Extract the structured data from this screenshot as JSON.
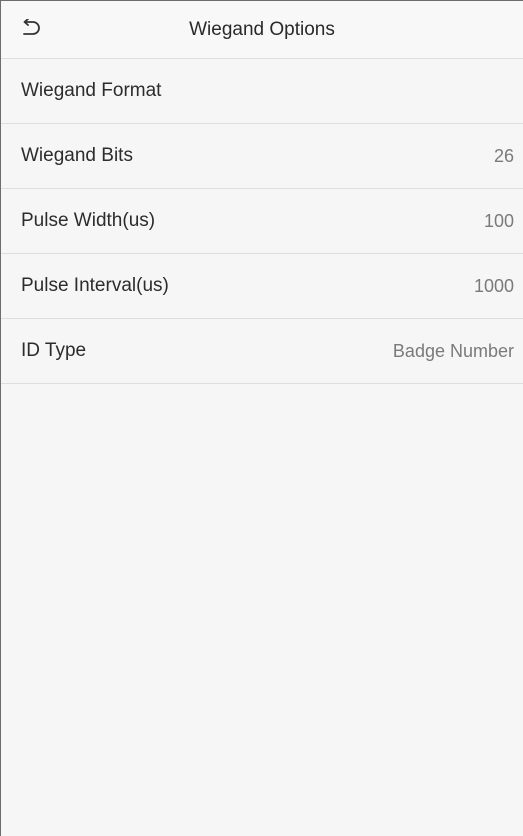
{
  "header": {
    "back_icon": "back-arrow-icon",
    "title": "Wiegand Options"
  },
  "rows": [
    {
      "label": "Wiegand Format",
      "value": ""
    },
    {
      "label": "Wiegand Bits",
      "value": "26"
    },
    {
      "label": "Pulse Width(us)",
      "value": "100"
    },
    {
      "label": "Pulse Interval(us)",
      "value": "1000"
    },
    {
      "label": "ID Type",
      "value": "Badge Number"
    }
  ],
  "colors": {
    "background": "#f6f6f6",
    "divider": "#dedede",
    "label_text": "#2c2c2c",
    "value_text": "#7a7a7a"
  }
}
